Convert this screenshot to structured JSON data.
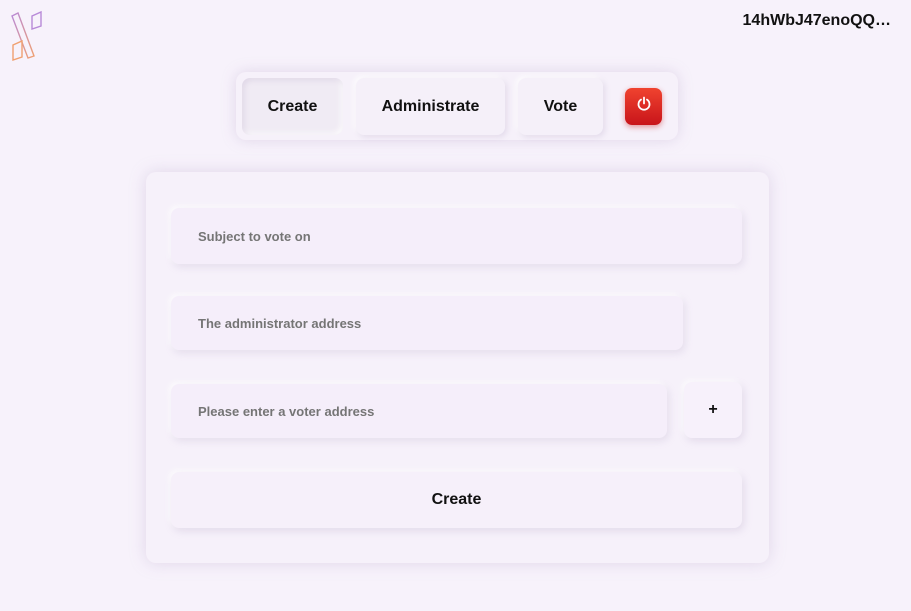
{
  "header": {
    "logo_icon": "app-logo-icon",
    "account_address": "14hWbJ47enoQQ…"
  },
  "nav": {
    "tabs": [
      {
        "label": "Create",
        "active": true
      },
      {
        "label": "Administrate",
        "active": false
      },
      {
        "label": "Vote",
        "active": false
      }
    ],
    "power_icon": "power-icon",
    "power_color": "#e0271f"
  },
  "form": {
    "subject_placeholder": "Subject to vote on",
    "admin_placeholder": "The administrator address",
    "voter_placeholder": "Please enter a voter address",
    "add_voter_label": "+",
    "create_label": "Create"
  },
  "colors": {
    "background": "#f7f2fb",
    "logo_purple": "#b88ad8",
    "logo_orange": "#f0a070"
  }
}
